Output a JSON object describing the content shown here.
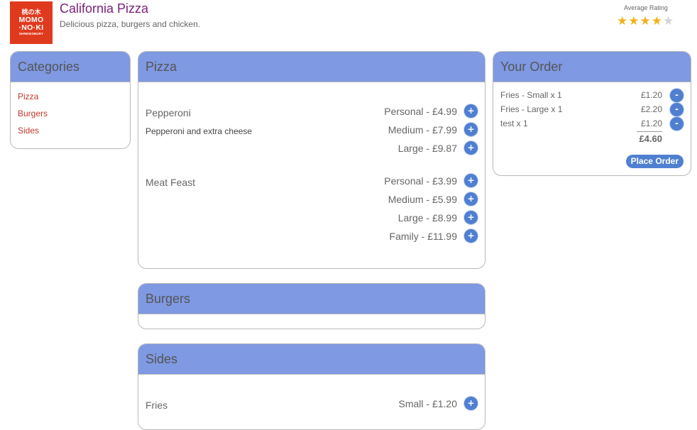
{
  "header": {
    "logo": {
      "top": "桃の木",
      "mid1": "MOMO",
      "mid2": "·NO·KI",
      "bottom": "SHREWSBURY"
    },
    "title": "California Pizza",
    "subtitle": "Delicious pizza, burgers and chicken.",
    "rating_label": "Average Rating",
    "rating_value": 4,
    "rating_max": 5
  },
  "categories": {
    "title": "Categories",
    "items": [
      "Pizza",
      "Burgers",
      "Sides"
    ]
  },
  "menu": {
    "pizza": {
      "title": "Pizza",
      "items": [
        {
          "name": "Pepperoni",
          "description": "Pepperoni and extra cheese",
          "prices": [
            "Personal - £4.99",
            "Medium - £7.99",
            "Large - £9.87"
          ]
        },
        {
          "name": "Meat Feast",
          "prices": [
            "Personal - £3.99",
            "Medium - £5.99",
            "Large - £8.99",
            "Family - £11.99"
          ]
        }
      ]
    },
    "burgers": {
      "title": "Burgers"
    },
    "sides": {
      "title": "Sides",
      "items": [
        {
          "name": "Fries",
          "prices": [
            "Small - £1.20"
          ]
        }
      ]
    }
  },
  "add_label": "+",
  "order": {
    "title": "Your Order",
    "rows": [
      {
        "name": "Fries - Small x 1",
        "price": "£1.20"
      },
      {
        "name": "Fries - Large x 1",
        "price": "£2.20"
      },
      {
        "name": "test x 1",
        "price": "£1.20"
      }
    ],
    "remove_label": "-",
    "total": "£4.60",
    "place_order": "Place Order"
  },
  "colors": {
    "header_band": "#7f99e2",
    "button": "#4f7fd0",
    "title": "#7a1f7a",
    "link": "#c0392b",
    "star": "#f2b21b"
  }
}
